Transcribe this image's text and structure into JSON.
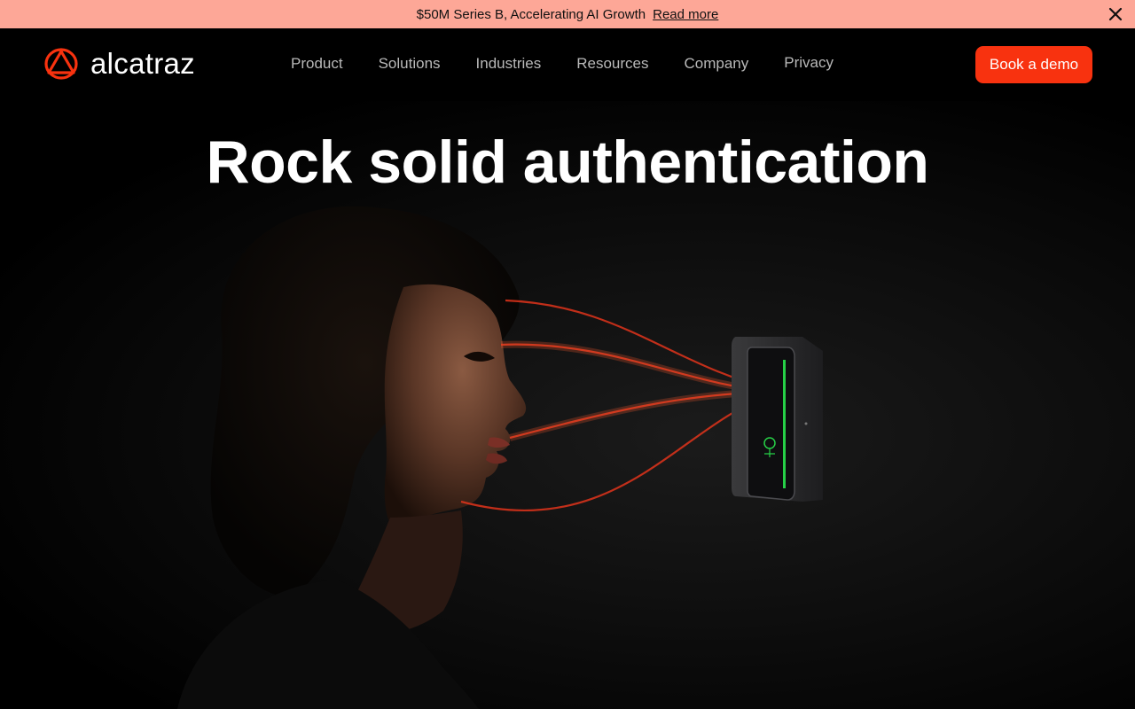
{
  "banner": {
    "message": "$50M Series B, Accelerating AI Growth",
    "link_label": "Read more",
    "close_icon": "close-icon",
    "background": "#fda797"
  },
  "nav": {
    "logo_text": "alcatraz",
    "logo_icon": "alcatraz-logo-icon",
    "items": [
      {
        "label": "Product"
      },
      {
        "label": "Solutions"
      },
      {
        "label": "Industries"
      },
      {
        "label": "Resources"
      },
      {
        "label": "Company"
      },
      {
        "label": "Privacy"
      }
    ],
    "cta_label": "Book a demo",
    "accent": "#f8320f"
  },
  "hero": {
    "title": "Rock solid authentication",
    "image_alt": "Woman in profile facing a wall-mounted face-authentication device with red scan lines"
  }
}
